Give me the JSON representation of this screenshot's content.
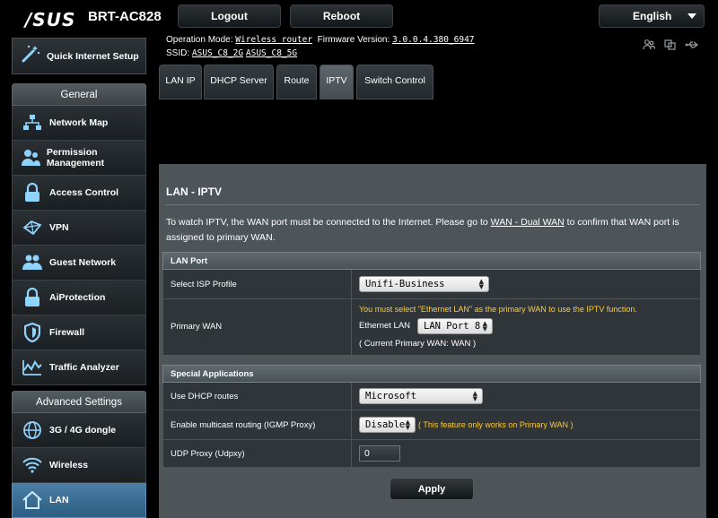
{
  "header": {
    "logo": "/SUS",
    "model": "BRT-AC828",
    "logout_label": "Logout",
    "reboot_label": "Reboot",
    "language": "English"
  },
  "info": {
    "operation_mode_label": "Operation Mode:",
    "operation_mode_value": "Wireless router",
    "firmware_label": "Firmware Version:",
    "firmware_value": "3.0.0.4.380_6947",
    "ssid_label": "SSID:",
    "ssid_2g": "ASUS_C8_2G",
    "ssid_5g": "ASUS_C8_5G"
  },
  "sidebar": {
    "quick_setup": "Quick Internet Setup",
    "general_header": "General",
    "general_items": [
      {
        "label": "Network Map",
        "icon": "network-map-icon"
      },
      {
        "label": "Permission Management",
        "icon": "users-icon"
      },
      {
        "label": "Access Control",
        "icon": "lock-icon"
      },
      {
        "label": "VPN",
        "icon": "vpn-icon"
      },
      {
        "label": "Guest Network",
        "icon": "guest-icon"
      },
      {
        "label": "AiProtection",
        "icon": "lock-icon"
      },
      {
        "label": "Firewall",
        "icon": "shield-icon"
      },
      {
        "label": "Traffic Analyzer",
        "icon": "chart-icon"
      }
    ],
    "advanced_header": "Advanced Settings",
    "advanced_items": [
      {
        "label": "3G / 4G dongle",
        "icon": "globe-icon"
      },
      {
        "label": "Wireless",
        "icon": "wifi-icon"
      },
      {
        "label": "LAN",
        "icon": "home-icon"
      }
    ]
  },
  "tabs": [
    "LAN IP",
    "DHCP Server",
    "Route",
    "IPTV",
    "Switch Control"
  ],
  "active_tab": "IPTV",
  "main": {
    "title": "LAN - IPTV",
    "desc_part1": "To watch IPTV, the WAN port must be connected to the Internet. Please go to ",
    "desc_link": "WAN - Dual WAN",
    "desc_part2": " to confirm that WAN port is assigned to primary WAN.",
    "lan_port_header": "LAN Port",
    "isp_profile_label": "Select ISP Profile",
    "isp_profile_value": "Unifi-Business",
    "primary_wan_label": "Primary WAN",
    "primary_wan_warning": "You must select \"Ethernet LAN\" as the primary WAN to use the IPTV function.",
    "ethernet_lan_label": "Ethernet LAN",
    "ethernet_lan_value": "LAN Port 8",
    "current_primary": "( Current Primary WAN: WAN )",
    "special_header": "Special Applications",
    "dhcp_routes_label": "Use DHCP routes",
    "dhcp_routes_value": "Microsoft",
    "multicast_label": "Enable multicast routing (IGMP Proxy)",
    "multicast_value": "Disable",
    "multicast_note": "( This feature only works on Primary WAN )",
    "udp_proxy_label": "UDP Proxy (Udpxy)",
    "udp_proxy_value": "0",
    "apply_label": "Apply"
  },
  "colors": {
    "active_menu": "#2c5d83",
    "warning": "#ffcc33",
    "panel": "#4d5559"
  }
}
